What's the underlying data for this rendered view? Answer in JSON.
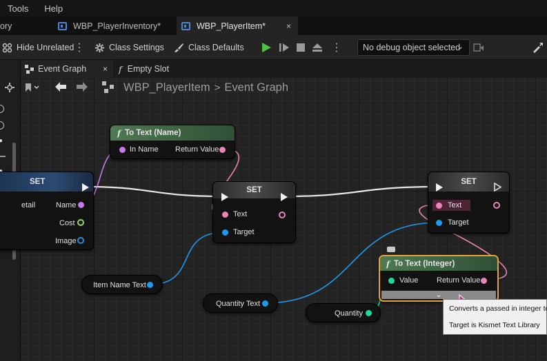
{
  "menu": {
    "items": [
      "Tools",
      "Help"
    ]
  },
  "doc_tabs": [
    {
      "label": "ory"
    },
    {
      "label": "WBP_PlayerInventory*"
    },
    {
      "label": "WBP_PlayerItem*",
      "close": "×"
    }
  ],
  "toolbar": {
    "hide_unrelated": "Hide Unrelated",
    "class_settings": "Class Settings",
    "class_defaults": "Class Defaults",
    "debug_object": "No debug object selected"
  },
  "graph_tabs": [
    {
      "label": "Event Graph",
      "close": "×"
    },
    {
      "label": "Empty Slot"
    }
  ],
  "breadcrumb": {
    "blueprint": "WBP_PlayerItem",
    "separator": ">",
    "graph": "Event Graph"
  },
  "nodes": {
    "set_left": {
      "title": "SET",
      "pins": [
        "etail",
        "Name",
        "Cost",
        "Image"
      ]
    },
    "to_text_name": {
      "title": "To Text (Name)",
      "in": "In Name",
      "out": "Return Value"
    },
    "set_mid": {
      "title": "SET",
      "pins": [
        "Text",
        "Target"
      ]
    },
    "set_right": {
      "title": "SET",
      "pins": [
        "Text",
        "Target"
      ]
    },
    "to_text_int": {
      "title": "To Text (Integer)",
      "in": "Value",
      "out": "Return Value",
      "expand": "⌄"
    },
    "item_name_text": {
      "label": "Item Name Text"
    },
    "quantity_text": {
      "label": "Quantity Text"
    },
    "quantity": {
      "label": "Quantity"
    }
  },
  "tooltip": {
    "line1": "Converts a passed in integer to",
    "line2": "Target is Kismet Text Library"
  },
  "colors": {
    "accent_orange": "#e8a33a",
    "pin_text": "#ea84b8",
    "pin_object": "#1b9bf0",
    "pin_int": "#1dd8a0",
    "pin_name": "#c878ee",
    "pin_struct_green": "#9ed36a",
    "pin_image": "#2f8ad8",
    "func_header": "#3f6a45",
    "set_header_blue": "#2b4b74",
    "set_header_gray": "#4a4a4a",
    "play_green": "#4cc144"
  }
}
